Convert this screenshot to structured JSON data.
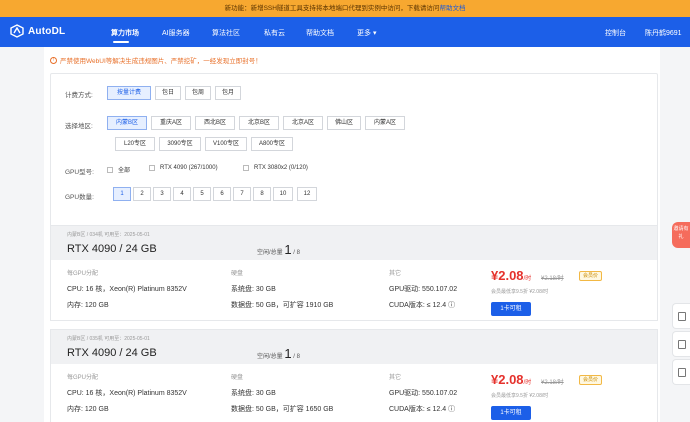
{
  "banner": {
    "text": "新功能：新增SSH隧道工具支持将本地端口代理到实例中访问，下载请访问",
    "link": "帮助文档"
  },
  "nav": {
    "logo": "AutoDL",
    "items": [
      "算力市场",
      "AI服务器",
      "算法社区",
      "私有云",
      "帮助文档",
      "更多"
    ],
    "console": "控制台",
    "user": "陈丹鹤9691"
  },
  "notice": "严禁使用WebUI等解决生成违规图片、严禁挖矿，一经发现立即封号！",
  "filters": {
    "billing": {
      "label": "计费方式:",
      "options": [
        "按量计费",
        "包日",
        "包周",
        "包月"
      ]
    },
    "region": {
      "label": "选择地区:",
      "options": [
        "内蒙B区",
        "重庆A区",
        "西北B区",
        "北京B区",
        "北京A区",
        "佛山区",
        "内蒙A区"
      ],
      "zones": [
        "L20专区",
        "3090专区",
        "V100专区",
        "A800专区"
      ]
    },
    "gpu_model": {
      "label": "GPU型号:",
      "options": [
        "全部",
        "RTX 4090 (267/1000)",
        "RTX 3080x2 (0/120)"
      ]
    },
    "gpu_count": {
      "label": "GPU数量:",
      "options": [
        "1",
        "2",
        "3",
        "4",
        "5",
        "6",
        "7",
        "8",
        "10",
        "12"
      ]
    }
  },
  "cards": [
    {
      "meta": "内蒙B区 / 034机    可用至：2025-05-01",
      "title": "RTX 4090 / 24 GB",
      "avail_label": "空闲/总量",
      "avail_free": "1",
      "avail_total": " / 8",
      "gpu_head": "每GPU分配",
      "cpu": "CPU:  16 核，Xeon(R) Platinum 8352V",
      "mem": "内存:  120 GB",
      "disk_head": "硬盘",
      "sys_disk": "系统盘:  30 GB",
      "data_disk": "数据盘:  50 GB，可扩容 1910 GB",
      "other_head": "其它",
      "driver": "GPU驱动:  550.107.02",
      "cuda": "CUDA版本:  ≤ 12.4",
      "price": "¥2.08",
      "price_unit": "/时",
      "orig_price": "¥2.18/时",
      "badge": "会员价",
      "member_note": "会员最低享9.5折  ¥2.08/时",
      "button": "1卡可租"
    },
    {
      "meta": "内蒙B区 / 035机    可用至：2025-05-01",
      "title": "RTX 4090 / 24 GB",
      "avail_label": "空闲/总量",
      "avail_free": "1",
      "avail_total": " / 8",
      "gpu_head": "每GPU分配",
      "cpu": "CPU:  16 核，Xeon(R) Platinum 8352V",
      "mem": "内存:  120 GB",
      "disk_head": "硬盘",
      "sys_disk": "系统盘:  30 GB",
      "data_disk": "数据盘:  50 GB，可扩容 1650 GB",
      "other_head": "其它",
      "driver": "GPU驱动:  550.107.02",
      "cuda": "CUDA版本:  ≤ 12.4",
      "price": "¥2.08",
      "price_unit": "/时",
      "orig_price": "¥2.18/时",
      "badge": "会员价",
      "member_note": "会员最低享9.5折  ¥2.08/时",
      "button": "1卡可租"
    }
  ],
  "side": {
    "promo": "邀请有礼"
  },
  "colors": {
    "brand": "#1c5fe8",
    "banner": "#f7a830",
    "price": "#e5322d"
  }
}
